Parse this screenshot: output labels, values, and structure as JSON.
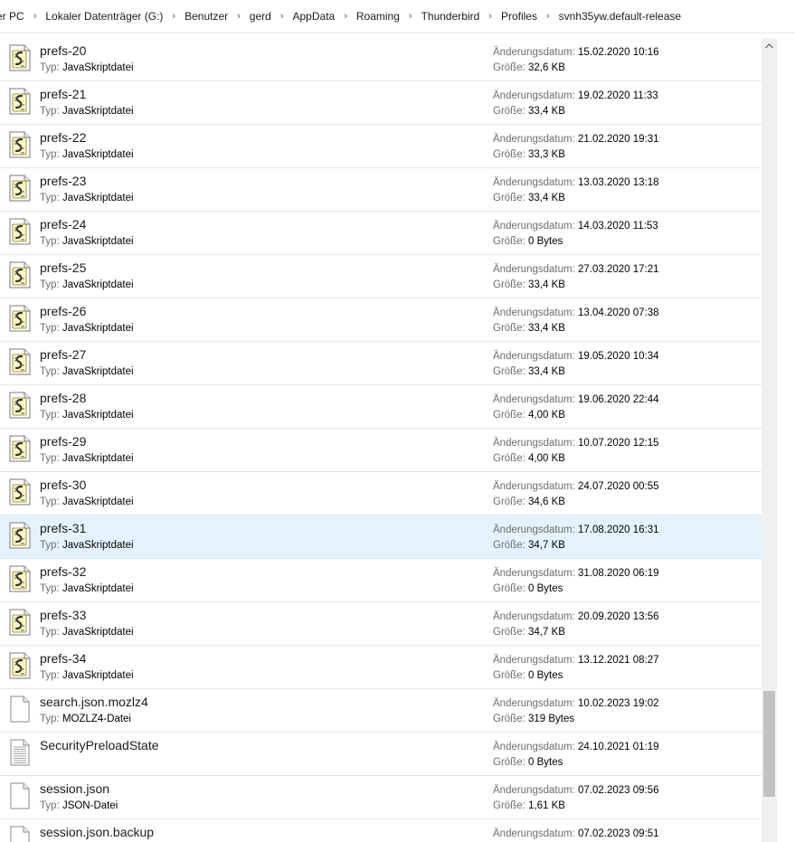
{
  "breadcrumb": [
    "er PC",
    "Lokaler Datenträger (G:)",
    "Benutzer",
    "gerd",
    "AppData",
    "Roaming",
    "Thunderbird",
    "Profiles",
    "svnh35yw.default-release"
  ],
  "labels": {
    "type": "Typ:",
    "date": "Änderungsdatum:",
    "size": "Größe:"
  },
  "files": [
    {
      "name": "prefs-20",
      "type": "JavaSkriptdatei",
      "date": "15.02.2020 10:16",
      "size": "32,6 KB",
      "icon": "script-file-icon"
    },
    {
      "name": "prefs-21",
      "type": "JavaSkriptdatei",
      "date": "19.02.2020 11:33",
      "size": "33,4 KB",
      "icon": "script-file-icon"
    },
    {
      "name": "prefs-22",
      "type": "JavaSkriptdatei",
      "date": "21.02.2020 19:31",
      "size": "33,3 KB",
      "icon": "script-file-icon"
    },
    {
      "name": "prefs-23",
      "type": "JavaSkriptdatei",
      "date": "13.03.2020 13:18",
      "size": "33,4 KB",
      "icon": "script-file-icon"
    },
    {
      "name": "prefs-24",
      "type": "JavaSkriptdatei",
      "date": "14.03.2020 11:53",
      "size": "0 Bytes",
      "icon": "script-file-icon"
    },
    {
      "name": "prefs-25",
      "type": "JavaSkriptdatei",
      "date": "27.03.2020 17:21",
      "size": "33,4 KB",
      "icon": "script-file-icon"
    },
    {
      "name": "prefs-26",
      "type": "JavaSkriptdatei",
      "date": "13.04.2020 07:38",
      "size": "33,4 KB",
      "icon": "script-file-icon"
    },
    {
      "name": "prefs-27",
      "type": "JavaSkriptdatei",
      "date": "19.05.2020 10:34",
      "size": "33,4 KB",
      "icon": "script-file-icon"
    },
    {
      "name": "prefs-28",
      "type": "JavaSkriptdatei",
      "date": "19.06.2020 22:44",
      "size": "4,00 KB",
      "icon": "script-file-icon"
    },
    {
      "name": "prefs-29",
      "type": "JavaSkriptdatei",
      "date": "10.07.2020 12:15",
      "size": "4,00 KB",
      "icon": "script-file-icon"
    },
    {
      "name": "prefs-30",
      "type": "JavaSkriptdatei",
      "date": "24.07.2020 00:55",
      "size": "34,6 KB",
      "icon": "script-file-icon"
    },
    {
      "name": "prefs-31",
      "type": "JavaSkriptdatei",
      "date": "17.08.2020 16:31",
      "size": "34,7 KB",
      "icon": "script-file-icon",
      "selected": true
    },
    {
      "name": "prefs-32",
      "type": "JavaSkriptdatei",
      "date": "31.08.2020 06:19",
      "size": "0 Bytes",
      "icon": "script-file-icon"
    },
    {
      "name": "prefs-33",
      "type": "JavaSkriptdatei",
      "date": "20.09.2020 13:56",
      "size": "34,7 KB",
      "icon": "script-file-icon"
    },
    {
      "name": "prefs-34",
      "type": "JavaSkriptdatei",
      "date": "13.12.2021 08:27",
      "size": "0 Bytes",
      "icon": "script-file-icon"
    },
    {
      "name": "search.json.mozlz4",
      "type": "MOZLZ4-Datei",
      "date": "10.02.2023 19:02",
      "size": "319 Bytes",
      "icon": "blank-file-icon"
    },
    {
      "name": "SecurityPreloadState",
      "type": "",
      "date": "24.10.2021 01:19",
      "size": "0 Bytes",
      "icon": "text-file-icon"
    },
    {
      "name": "session.json",
      "type": "JSON-Datei",
      "date": "07.02.2023 09:56",
      "size": "1,61 KB",
      "icon": "blank-file-icon"
    },
    {
      "name": "session.json.backup",
      "type": "",
      "date": "07.02.2023 09:51",
      "size": "",
      "icon": "blank-file-icon"
    }
  ]
}
